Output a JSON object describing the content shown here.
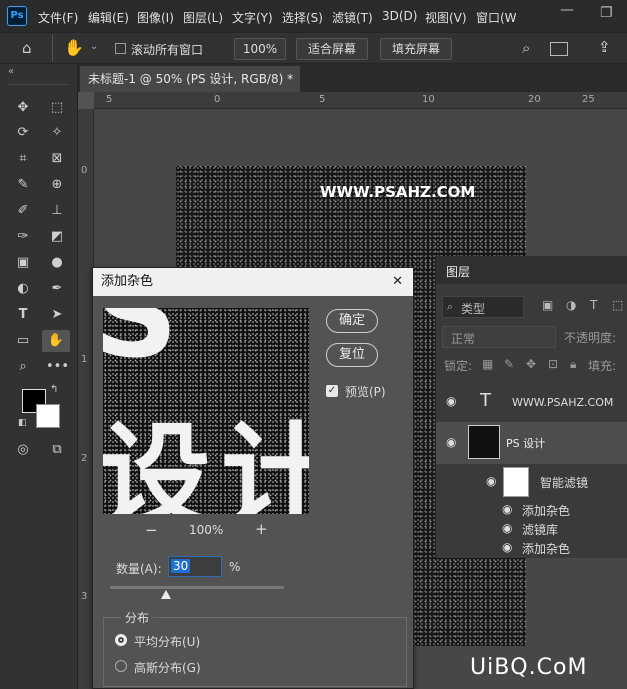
{
  "menubar": {
    "logo": "Ps",
    "items": [
      "文件(F)",
      "编辑(E)",
      "图像(I)",
      "图层(L)",
      "文字(Y)",
      "选择(S)",
      "滤镜(T)",
      "3D(D)",
      "视图(V)",
      "窗口(W"
    ],
    "minimize": "—",
    "restore": "❐"
  },
  "options": {
    "scroll_all_label": "滚动所有窗口",
    "zoom_value": "100%",
    "fit_screen": "适合屏幕",
    "fill_screen": "填充屏幕"
  },
  "tab": {
    "title": "未标题-1 @ 50% (PS 设计, RGB/8) *",
    "close": "×"
  },
  "ruler": {
    "h_ticks": [
      "5",
      "0",
      "5",
      "10",
      "15",
      "20",
      "25"
    ],
    "v_ticks": [
      "0",
      "5",
      "1",
      "0",
      "1",
      "5",
      "2",
      "0",
      "2",
      "5",
      "3",
      "0"
    ]
  },
  "canvas": {
    "watermark": "WWW.PSAHZ.COM"
  },
  "layers": {
    "title": "图层",
    "filter_label": "类型",
    "blend_mode": "正常",
    "opacity_label": "不透明度:",
    "lock_label": "锁定:",
    "fill_label": "填充:",
    "rows": [
      {
        "name": "WWW.PSAHZ.COM",
        "kind": "T"
      },
      {
        "name": "PS 设计",
        "kind": "smart"
      },
      {
        "name": "智能滤镜",
        "kind": "filter-mask"
      },
      {
        "name": "添加杂色",
        "kind": "filter"
      },
      {
        "name": "滤镜库",
        "kind": "filter"
      },
      {
        "name": "添加杂色",
        "kind": "filter"
      }
    ]
  },
  "dialog": {
    "title": "添加杂色",
    "close": "✕",
    "ok": "确定",
    "reset": "复位",
    "preview_label": "预览(P)",
    "zoom_out": "−",
    "zoom_level": "100%",
    "zoom_in": "+",
    "amount_label": "数量(A):",
    "amount_value": "30",
    "amount_unit": "%",
    "distribution_label": "分布",
    "uniform": "平均分布(U)",
    "gaussian": "高斯分布(G)",
    "preview_glyphs": [
      "S",
      "设",
      "计"
    ]
  },
  "watermark_bottom": "UiBQ.CoM"
}
